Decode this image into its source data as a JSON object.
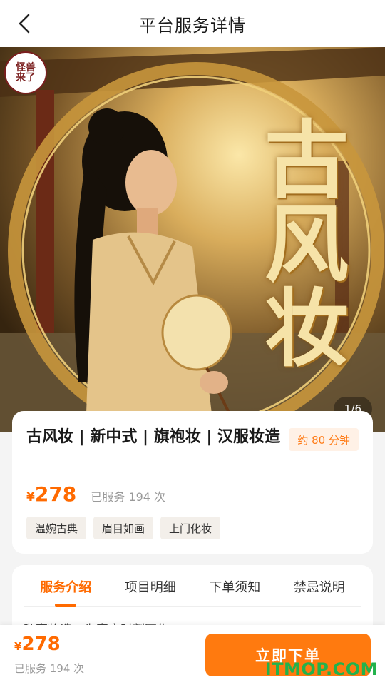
{
  "nav": {
    "title": "平台服务详情",
    "back_icon": "chevron-left-icon"
  },
  "hero": {
    "logo_text": "怪兽来了",
    "overlay_title": "古风妆",
    "counter": "1/6",
    "colors": {
      "gold": "#f6e3a8",
      "dark": "#3e2a12"
    }
  },
  "service": {
    "name": "古风妆 | 新中式 | 旗袍妆 | 汉服妆造",
    "duration": "约 80 分钟",
    "currency": "¥",
    "price": "278",
    "served": "已服务 194 次",
    "tags": [
      "温婉古典",
      "眉目如画",
      "上门化妆"
    ]
  },
  "tabs": {
    "items": [
      "服务介绍",
      "项目明细",
      "下单须知",
      "禁忌说明"
    ],
    "active_index": 0
  },
  "intro_text": "私享妆造，为客户时刻写作",
  "bottom": {
    "currency": "¥",
    "price": "278",
    "served": "已服务 194 次",
    "order_label": "立即下单"
  },
  "watermark": "ITMOP.COM",
  "colors": {
    "accent": "#ff6a00",
    "button": "#ff7a0f",
    "watermark": "#22b24c"
  }
}
